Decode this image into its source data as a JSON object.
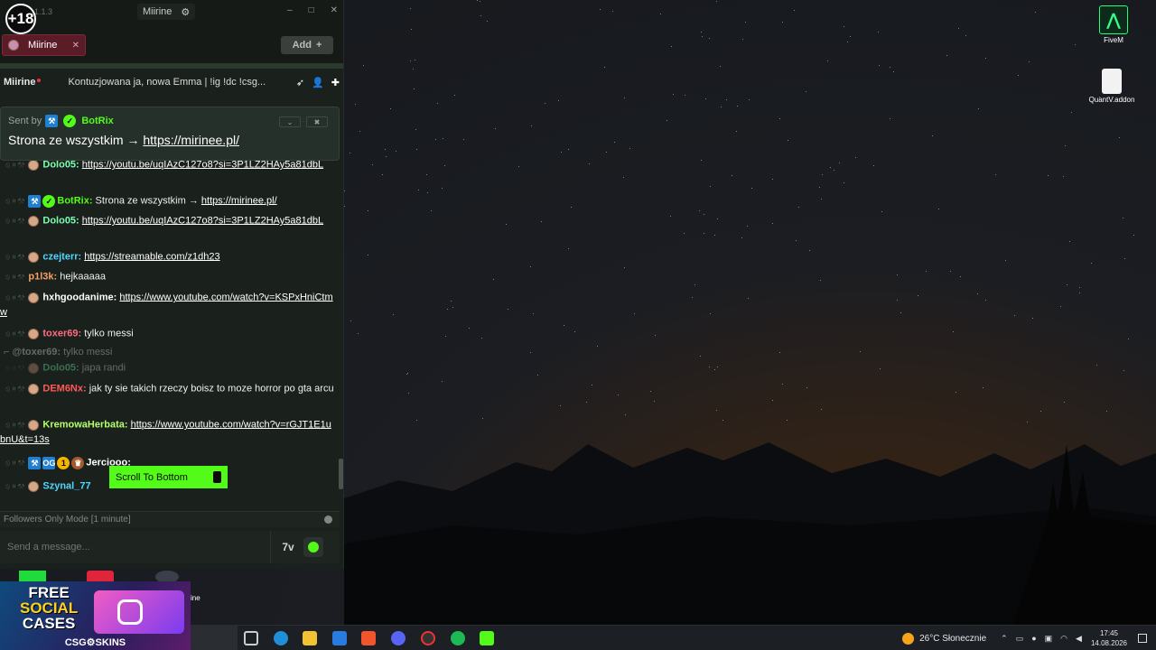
{
  "titlebar": {
    "age_badge": "+18",
    "version": "1.1.3",
    "window_title": "Miirine",
    "settings_icon": "gear-icon",
    "controls": [
      "–",
      "□",
      "✕"
    ]
  },
  "tabs": {
    "channel_tab": "Miirine",
    "add_label": "Add"
  },
  "channel": {
    "name": "Miirine",
    "topic": "Kontuzjowana ja, nowa Emma | !ig !dc !csg..."
  },
  "pinned": {
    "sent_by": "Sent by",
    "sender": "BotRix",
    "text": "Strona ze wszystkim → ",
    "link": "https://mirinee.pl/"
  },
  "messages": [
    {
      "user": "Dolo05:",
      "text": "",
      "link": "https://youtu.be/uqIAzC127o8?si=3P1LZ2HAy5a81dbL",
      "color": "#7bffb1"
    },
    {
      "user": "BotRix:",
      "text": "Strona ze wszystkim → ",
      "link": "https://mirinee.pl/",
      "color": "#53fc18"
    },
    {
      "user": "Dolo05:",
      "text": "",
      "link": "https://youtu.be/uqIAzC127o8?si=3P1LZ2HAy5a81dbL",
      "color": "#7bffb1"
    },
    {
      "user": "czejterr:",
      "text": "",
      "link": "https://streamable.com/z1dh23",
      "color": "#4fd8ff"
    },
    {
      "user": "p1l3k:",
      "text": "hejkaaaaa",
      "link": "",
      "color": "#f4a261"
    },
    {
      "user": "hxhgoodanime:",
      "text": "",
      "link": "https://www.youtube.com/watch?v=KSPxHniCtmw",
      "color": "#ffffff"
    },
    {
      "user": "toxer69:",
      "text": "tylko messi",
      "link": "",
      "color": "#ff6b81"
    },
    {
      "user": "@toxer69:",
      "text": "tylko messi",
      "link": "",
      "color": "#cccccc"
    },
    {
      "user": "Dolo05:",
      "text": "japa randi",
      "link": "",
      "color": "#7bffb1"
    },
    {
      "user": "DEM6Nx:",
      "text": "jak ty sie takich rzeczy boisz to moze horror po gta arcu",
      "link": "",
      "color": "#ff5a5a"
    },
    {
      "user": "KremowaHerbata:",
      "text": "",
      "link": "https://www.youtube.com/watch?v=rGJT1E1ubnU&t=13s",
      "color": "#b6ff6b"
    },
    {
      "user": "Jerciooo:",
      "text": "",
      "link": "",
      "color": "#ffffff"
    },
    {
      "user": "Szynal_77",
      "text": "",
      "link": "",
      "color": "#4fd8ff"
    }
  ],
  "scroll_to_bottom": "Scroll To Bottom",
  "followers_mode": "Followers Only Mode [1 minute]",
  "input": {
    "placeholder": "Send a message..."
  },
  "desktop": {
    "icons": [
      "FiveM",
      "QuantV.addon"
    ],
    "partial_label": "ine"
  },
  "ad": {
    "line1": "FREE",
    "line2": "SOCIAL",
    "line3": "CASES",
    "brand": "CSG⚙SKINS"
  },
  "taskbar": {
    "weather": "26°C  Słonecznie",
    "time": "17:45",
    "date": "14.08.2026"
  },
  "colors": {
    "accent": "#53fc18",
    "chat_bg": "#1a201c"
  }
}
